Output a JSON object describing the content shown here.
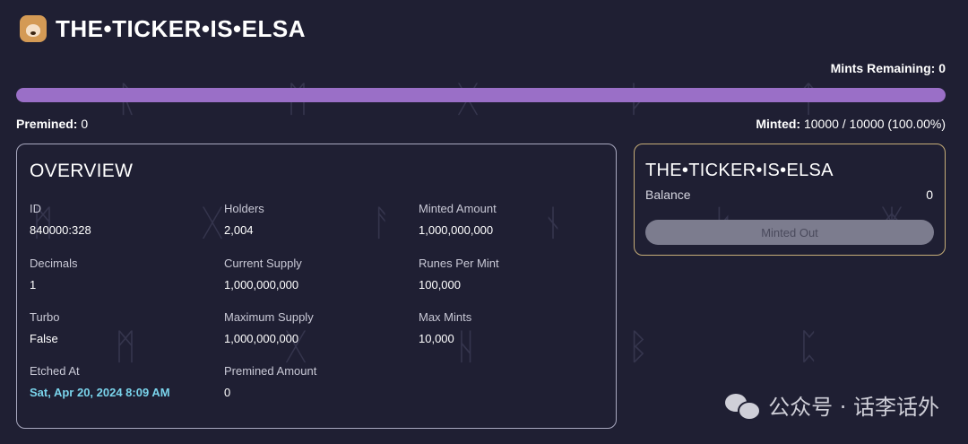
{
  "header": {
    "title": "THE•TICKER•IS•ELSA",
    "icon": "dog-token-icon"
  },
  "mint_stats": {
    "mints_remaining_label": "Mints Remaining:",
    "mints_remaining_value": "0",
    "progress_percent": 100,
    "premined_label": "Premined:",
    "premined_value": "0",
    "minted_label": "Minted:",
    "minted_value": "10000 / 10000 (100.00%)"
  },
  "overview": {
    "title": "OVERVIEW",
    "fields": [
      {
        "label": "ID",
        "value": "840000:328"
      },
      {
        "label": "Holders",
        "value": "2,004"
      },
      {
        "label": "Minted Amount",
        "value": "1,000,000,000"
      },
      {
        "label": "Decimals",
        "value": "1"
      },
      {
        "label": "Current Supply",
        "value": "1,000,000,000"
      },
      {
        "label": "Runes Per Mint",
        "value": "100,000"
      },
      {
        "label": "Turbo",
        "value": "False"
      },
      {
        "label": "Maximum Supply",
        "value": "1,000,000,000"
      },
      {
        "label": "Max Mints",
        "value": "10,000"
      },
      {
        "label": "Etched At",
        "value": "Sat, Apr 20, 2024 8:09 AM"
      },
      {
        "label": "Premined Amount",
        "value": "0"
      }
    ]
  },
  "balance_card": {
    "title": "THE•TICKER•IS•ELSA",
    "balance_label": "Balance",
    "balance_value": "0",
    "button_label": "Minted Out"
  },
  "watermark": {
    "text": "公众号 · 话李话外",
    "icon": "wechat-icon"
  },
  "colors": {
    "background": "#1f1f33",
    "progress_fill": "#9a6fc7",
    "date_accent": "#7ad4ec",
    "balance_border": "#c6ad78"
  }
}
